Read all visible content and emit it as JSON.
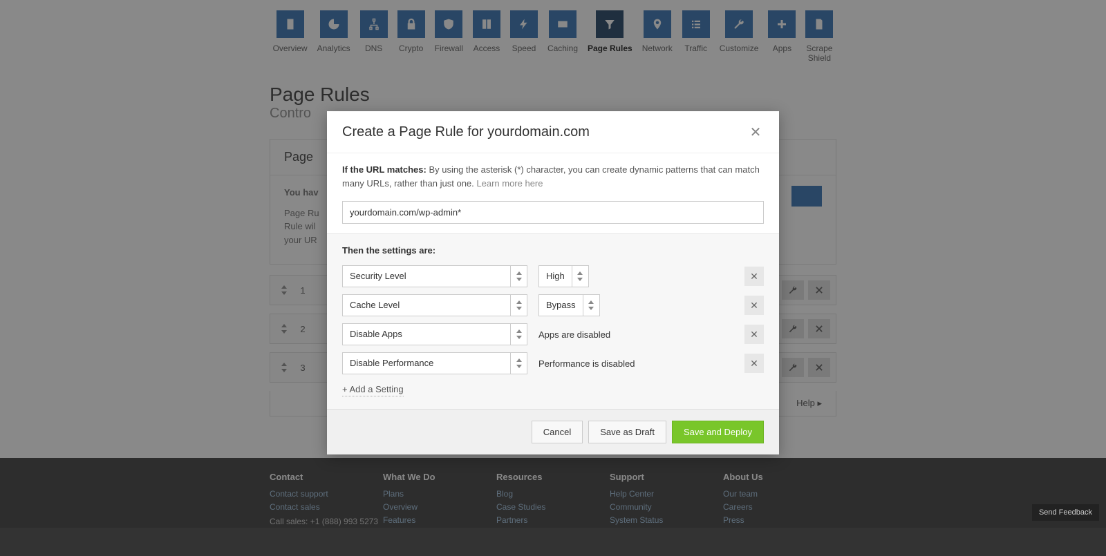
{
  "nav": [
    {
      "label": "Overview",
      "icon": "doc"
    },
    {
      "label": "Analytics",
      "icon": "pie"
    },
    {
      "label": "DNS",
      "icon": "sitemap"
    },
    {
      "label": "Crypto",
      "icon": "lock"
    },
    {
      "label": "Firewall",
      "icon": "shield"
    },
    {
      "label": "Access",
      "icon": "book"
    },
    {
      "label": "Speed",
      "icon": "bolt"
    },
    {
      "label": "Caching",
      "icon": "card"
    },
    {
      "label": "Page Rules",
      "icon": "funnel",
      "active": true
    },
    {
      "label": "Network",
      "icon": "marker"
    },
    {
      "label": "Traffic",
      "icon": "list"
    },
    {
      "label": "Customize",
      "icon": "wrench"
    },
    {
      "label": "Apps",
      "icon": "plus"
    },
    {
      "label": "Scrape\nShield",
      "icon": "doc2"
    }
  ],
  "page": {
    "title": "Page Rules",
    "subtitle_prefix": "Contro"
  },
  "card": {
    "header": "Page",
    "line1": "You hav",
    "body_prefix": "Page Ru\nRule wil\nyour UR"
  },
  "rules": [
    {
      "n": "1"
    },
    {
      "n": "2"
    },
    {
      "n": "3"
    }
  ],
  "help": "Help ▸",
  "footer": {
    "contact": {
      "title": "Contact",
      "links": [
        "Contact support",
        "Contact sales"
      ],
      "call_label": "Call sales: ",
      "call_number": "+1 (888) 993 5273"
    },
    "whatwedo": {
      "title": "What We Do",
      "links": [
        "Plans",
        "Overview",
        "Features"
      ]
    },
    "resources": {
      "title": "Resources",
      "links": [
        "Blog",
        "Case Studies",
        "Partners"
      ]
    },
    "support": {
      "title": "Support",
      "links": [
        "Help Center",
        "Community",
        "System Status"
      ]
    },
    "about": {
      "title": "About Us",
      "links": [
        "Our team",
        "Careers",
        "Press"
      ]
    }
  },
  "modal": {
    "title": "Create a Page Rule for yourdomain.com",
    "url_label": "If the URL matches:",
    "url_desc": " By using the asterisk (*) character, you can create dynamic patterns that can match many URLs, rather than just one. ",
    "learn_more": "Learn more here",
    "url_value": "yourdomain.com/wp-admin*",
    "settings_title": "Then the settings are:",
    "settings": [
      {
        "name": "Security Level",
        "value_type": "select",
        "value": "High"
      },
      {
        "name": "Cache Level",
        "value_type": "select",
        "value": "Bypass"
      },
      {
        "name": "Disable Apps",
        "value_type": "text",
        "value": "Apps are disabled"
      },
      {
        "name": "Disable Performance",
        "value_type": "text",
        "value": "Performance is disabled"
      }
    ],
    "add_setting": "+ Add a Setting",
    "buttons": {
      "cancel": "Cancel",
      "draft": "Save as Draft",
      "deploy": "Save and Deploy"
    }
  },
  "feedback": "Send Feedback"
}
